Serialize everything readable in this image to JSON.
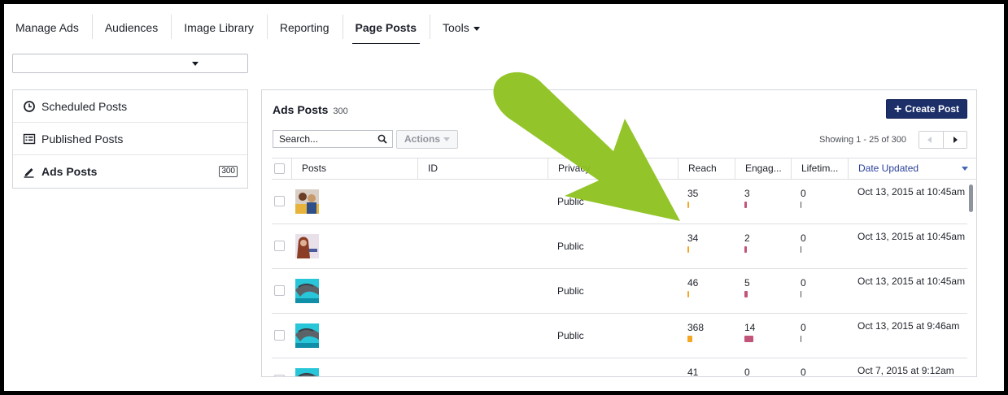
{
  "nav": {
    "tabs": [
      {
        "label": "Manage Ads"
      },
      {
        "label": "Audiences"
      },
      {
        "label": "Image Library"
      },
      {
        "label": "Reporting"
      },
      {
        "label": "Page Posts",
        "active": true
      },
      {
        "label": "Tools"
      }
    ]
  },
  "account_selector": {
    "value": ""
  },
  "sidebar": {
    "items": [
      {
        "label": "Scheduled Posts",
        "icon": "clock-icon"
      },
      {
        "label": "Published Posts",
        "icon": "list-icon"
      },
      {
        "label": "Ads Posts",
        "icon": "pencil-icon",
        "badge": "300",
        "active": true
      }
    ]
  },
  "panel": {
    "title": "Ads Posts",
    "count": "300",
    "create_button": "Create Post",
    "search_placeholder": "Search...",
    "actions_label": "Actions",
    "showing": "Showing 1 - 25 of 300"
  },
  "table": {
    "columns": [
      "Posts",
      "ID",
      "Privacy",
      "Reach",
      "Engag...",
      "Lifetim...",
      "Date Updated"
    ],
    "rows": [
      {
        "privacy": "Public",
        "reach": "35",
        "engagement": "3",
        "lifetime": "0",
        "date": "Oct 13, 2015 at 10:45am",
        "reach_bar": 35,
        "eng_bar": 3,
        "thumb": "family"
      },
      {
        "privacy": "Public",
        "reach": "34",
        "engagement": "2",
        "lifetime": "0",
        "date": "Oct 13, 2015 at 10:45am",
        "reach_bar": 34,
        "eng_bar": 2,
        "thumb": "woman"
      },
      {
        "privacy": "Public",
        "reach": "46",
        "engagement": "5",
        "lifetime": "0",
        "date": "Oct 13, 2015 at 10:45am",
        "reach_bar": 46,
        "eng_bar": 5,
        "thumb": "dolphin"
      },
      {
        "privacy": "Public",
        "reach": "368",
        "engagement": "14",
        "lifetime": "0",
        "date": "Oct 13, 2015 at 9:46am",
        "reach_bar": 368,
        "eng_bar": 14,
        "thumb": "dolphin"
      },
      {
        "privacy": "",
        "reach": "41",
        "engagement": "0",
        "lifetime": "0",
        "date": "Oct 7, 2015 at 9:12am",
        "reach_bar": 41,
        "eng_bar": 0,
        "thumb": "dolphin"
      }
    ]
  },
  "colors": {
    "create_button": "#1c2f69",
    "reach_bar": "#f5a623",
    "engagement_bar": "#c2547a",
    "annotation_arrow": "#8dc21f",
    "sorted_header": "#2a3f9a"
  }
}
